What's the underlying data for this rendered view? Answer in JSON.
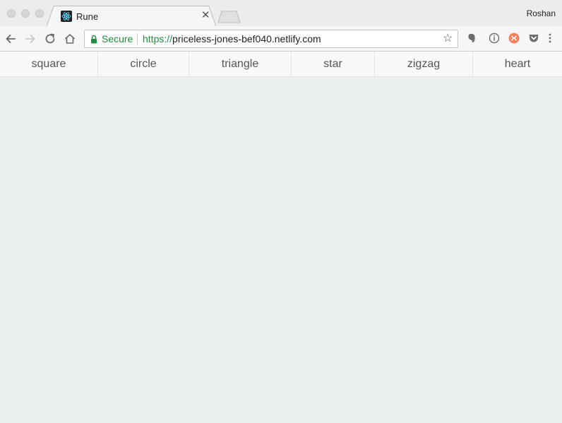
{
  "browser": {
    "tab": {
      "title": "Rune",
      "favicon": "react-atom-icon"
    },
    "profile": "Roshan",
    "address": {
      "secure_label": "Secure",
      "url_scheme": "https://",
      "url_host": "priceless-jones-bef040.netlify.com"
    },
    "icons": [
      "back-icon",
      "forward-icon",
      "reload-icon",
      "home-icon",
      "bookmark-star-icon",
      "evernote-icon",
      "info-icon",
      "extension-icon",
      "pocket-icon",
      "menu-icon"
    ]
  },
  "nav": {
    "items": [
      {
        "label": "square"
      },
      {
        "label": "circle"
      },
      {
        "label": "triangle"
      },
      {
        "label": "star"
      },
      {
        "label": "zigzag"
      },
      {
        "label": "heart"
      }
    ]
  },
  "colors": {
    "secure_green": "#1e8e3e",
    "content_bg": "#ecf0f1",
    "nav_bg": "#f9f9f9",
    "nav_text": "#555555"
  }
}
